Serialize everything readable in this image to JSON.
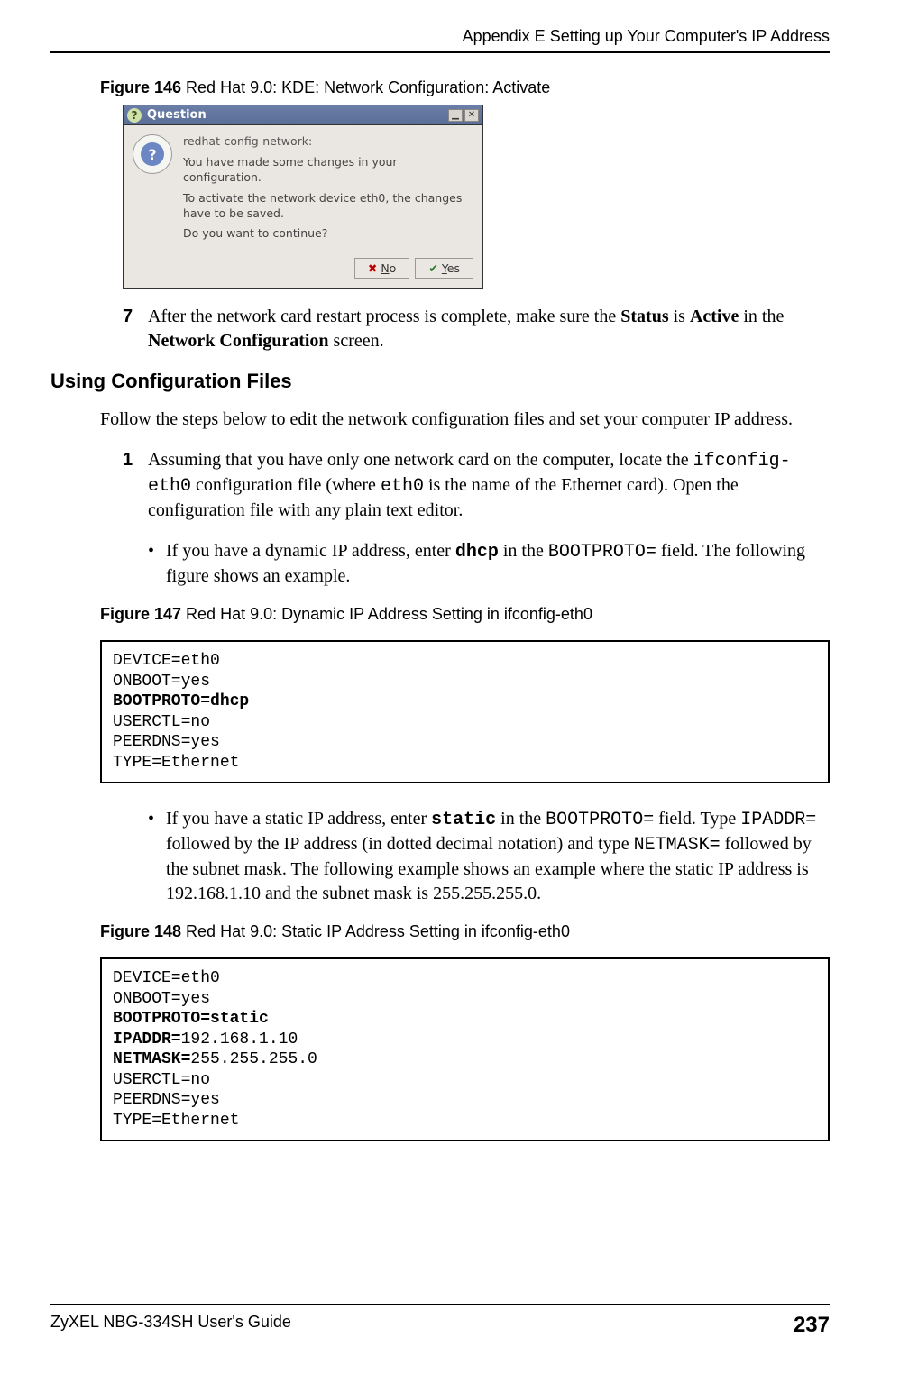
{
  "header": {
    "title": "Appendix E Setting up Your Computer's IP Address"
  },
  "fig146": {
    "label_prefix": "Figure 146",
    "label_text": "   Red Hat 9.0: KDE: Network Configuration: Activate"
  },
  "dialog": {
    "title": "Question",
    "app_name": "redhat-config-network:",
    "line1": "You have made some changes in your configuration.",
    "line2": "To activate the network device eth0, the changes have to be saved.",
    "line3": "Do you want to continue?",
    "no_label_char": "N",
    "no_label_rest": "o",
    "yes_label_char": "Y",
    "yes_label_rest": "es"
  },
  "step7": {
    "num": "7",
    "pre": "After the network card restart process is complete, make sure the ",
    "bold1": "Status",
    "mid1": " is ",
    "bold2": "Active",
    "mid2": " in the ",
    "bold3": "Network Configuration",
    "post": " screen."
  },
  "section_heading": "Using Configuration Files",
  "para_intro": "Follow the steps below to edit the network configuration files and set your computer IP address.",
  "step1": {
    "num": "1",
    "pre": "Assuming that you have only one network card on the computer, locate the ",
    "mono1": "ifconfig-eth0",
    "mid1": " configuration file (where ",
    "mono2": "eth0",
    "post": " is the name of the Ethernet card). Open the configuration file with any plain text editor."
  },
  "bullet_dhcp": {
    "pre": "If you have a dynamic IP address, enter ",
    "bold_mono": "dhcp",
    "mid": " in the ",
    "mono": "BOOTPROTO=",
    "post": " field.  The following figure shows an example."
  },
  "fig147": {
    "label_prefix": "Figure 147",
    "label_text": "   Red Hat 9.0: Dynamic IP Address Setting in ifconfig-eth0"
  },
  "code147": {
    "l1": "DEVICE=eth0",
    "l2": "ONBOOT=yes",
    "l3": "BOOTPROTO=dhcp",
    "l4": "USERCTL=no",
    "l5": "PEERDNS=yes",
    "l6": "TYPE=Ethernet"
  },
  "bullet_static": {
    "pre": "If you have a static IP address, enter ",
    "bold_mono": "static",
    "mid1": " in the ",
    "mono1": "BOOTPROTO=",
    "mid2": " field. Type ",
    "mono2": "IPADDR=",
    "mid3": " followed by the IP address (in dotted decimal notation) and type ",
    "mono3": "NETMASK=",
    "post": " followed by the subnet mask. The following example shows an example where the static IP address is 192.168.1.10 and the subnet mask is 255.255.255.0."
  },
  "fig148": {
    "label_prefix": "Figure 148",
    "label_text": "   Red Hat 9.0: Static IP Address Setting in ifconfig-eth0"
  },
  "code148": {
    "l1": "DEVICE=eth0",
    "l2": "ONBOOT=yes",
    "l3a": "BOOTPROTO=static",
    "l4a": "IPADDR=",
    "l4b": "192.168.1.10",
    "l5a": "NETMASK=",
    "l5b": "255.255.255.0",
    "l6": "USERCTL=no",
    "l7": "PEERDNS=yes",
    "l8": "TYPE=Ethernet"
  },
  "footer": {
    "guide": "ZyXEL NBG-334SH User's Guide",
    "page": "237"
  }
}
